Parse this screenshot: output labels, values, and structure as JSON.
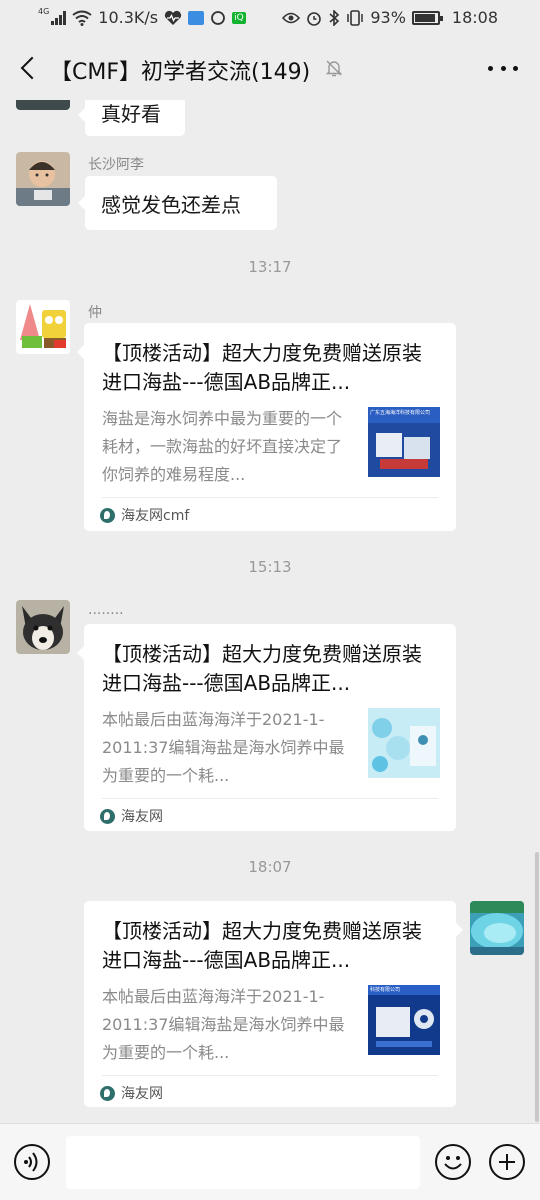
{
  "status_bar": {
    "network_type": "4G",
    "speed": "10.3K/s",
    "battery": "93%",
    "battery_level": 0.93,
    "time": "18:08"
  },
  "header": {
    "title": "【CMF】初学者交流(149)",
    "back_icon": "back-arrow-icon",
    "mute_icon": "bell-muted-icon",
    "more_icon": "more-dots-icon"
  },
  "messages": {
    "m0": {
      "text": "真好看"
    },
    "m1": {
      "sender": "长沙阿李",
      "text": "感觉发色还差点"
    },
    "t1": "13:17",
    "m2": {
      "sender": "仲",
      "title": "【顶楼活动】超大力度免费赠送原装进口海盐---德国AB品牌正...",
      "desc": "海盐是海水饲养中最为重要的一个耗材，一款海盐的好坏直接决定了你饲养的难易程度...",
      "thumb_caption": "广东五海海洋科技有限公司",
      "source": "海友网cmf"
    },
    "t2": "15:13",
    "m3": {
      "sender": "........",
      "title": "【顶楼活动】超大力度免费赠送原装进口海盐---德国AB品牌正...",
      "desc": "本帖最后由蓝海海洋于2021-1-2011:37编辑海盐是海水饲养中最为重要的一个耗...",
      "source": "海友网"
    },
    "t3": "18:07",
    "m4": {
      "title": "【顶楼活动】超大力度免费赠送原装进口海盐---德国AB品牌正...",
      "desc": "本帖最后由蓝海海洋于2021-1-2011:37编辑海盐是海水饲养中最为重要的一个耗...",
      "thumb_caption": "科技有限公司",
      "source": "海友网"
    }
  },
  "input_bar": {
    "placeholder": "",
    "voice_icon": "voice-icon",
    "emoji_icon": "emoji-icon",
    "plus_icon": "plus-icon"
  },
  "colors": {
    "background": "#ededed",
    "bubble": "#ffffff",
    "source_icon": "#2f6f6b"
  }
}
